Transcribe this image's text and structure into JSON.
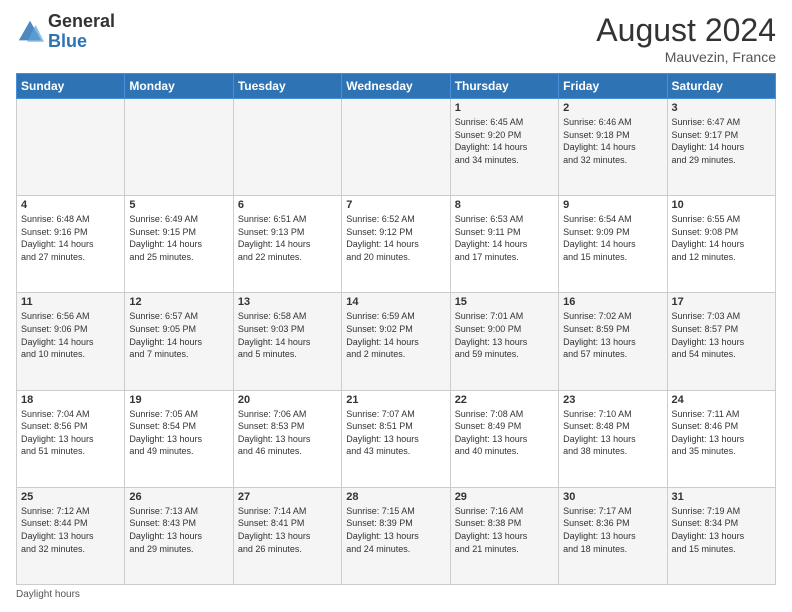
{
  "header": {
    "logo_general": "General",
    "logo_blue": "Blue",
    "month_year": "August 2024",
    "location": "Mauvezin, France"
  },
  "days_of_week": [
    "Sunday",
    "Monday",
    "Tuesday",
    "Wednesday",
    "Thursday",
    "Friday",
    "Saturday"
  ],
  "footer": {
    "daylight_label": "Daylight hours"
  },
  "weeks": [
    {
      "days": [
        {
          "num": "",
          "info": ""
        },
        {
          "num": "",
          "info": ""
        },
        {
          "num": "",
          "info": ""
        },
        {
          "num": "",
          "info": ""
        },
        {
          "num": "1",
          "info": "Sunrise: 6:45 AM\nSunset: 9:20 PM\nDaylight: 14 hours\nand 34 minutes."
        },
        {
          "num": "2",
          "info": "Sunrise: 6:46 AM\nSunset: 9:18 PM\nDaylight: 14 hours\nand 32 minutes."
        },
        {
          "num": "3",
          "info": "Sunrise: 6:47 AM\nSunset: 9:17 PM\nDaylight: 14 hours\nand 29 minutes."
        }
      ]
    },
    {
      "days": [
        {
          "num": "4",
          "info": "Sunrise: 6:48 AM\nSunset: 9:16 PM\nDaylight: 14 hours\nand 27 minutes."
        },
        {
          "num": "5",
          "info": "Sunrise: 6:49 AM\nSunset: 9:15 PM\nDaylight: 14 hours\nand 25 minutes."
        },
        {
          "num": "6",
          "info": "Sunrise: 6:51 AM\nSunset: 9:13 PM\nDaylight: 14 hours\nand 22 minutes."
        },
        {
          "num": "7",
          "info": "Sunrise: 6:52 AM\nSunset: 9:12 PM\nDaylight: 14 hours\nand 20 minutes."
        },
        {
          "num": "8",
          "info": "Sunrise: 6:53 AM\nSunset: 9:11 PM\nDaylight: 14 hours\nand 17 minutes."
        },
        {
          "num": "9",
          "info": "Sunrise: 6:54 AM\nSunset: 9:09 PM\nDaylight: 14 hours\nand 15 minutes."
        },
        {
          "num": "10",
          "info": "Sunrise: 6:55 AM\nSunset: 9:08 PM\nDaylight: 14 hours\nand 12 minutes."
        }
      ]
    },
    {
      "days": [
        {
          "num": "11",
          "info": "Sunrise: 6:56 AM\nSunset: 9:06 PM\nDaylight: 14 hours\nand 10 minutes."
        },
        {
          "num": "12",
          "info": "Sunrise: 6:57 AM\nSunset: 9:05 PM\nDaylight: 14 hours\nand 7 minutes."
        },
        {
          "num": "13",
          "info": "Sunrise: 6:58 AM\nSunset: 9:03 PM\nDaylight: 14 hours\nand 5 minutes."
        },
        {
          "num": "14",
          "info": "Sunrise: 6:59 AM\nSunset: 9:02 PM\nDaylight: 14 hours\nand 2 minutes."
        },
        {
          "num": "15",
          "info": "Sunrise: 7:01 AM\nSunset: 9:00 PM\nDaylight: 13 hours\nand 59 minutes."
        },
        {
          "num": "16",
          "info": "Sunrise: 7:02 AM\nSunset: 8:59 PM\nDaylight: 13 hours\nand 57 minutes."
        },
        {
          "num": "17",
          "info": "Sunrise: 7:03 AM\nSunset: 8:57 PM\nDaylight: 13 hours\nand 54 minutes."
        }
      ]
    },
    {
      "days": [
        {
          "num": "18",
          "info": "Sunrise: 7:04 AM\nSunset: 8:56 PM\nDaylight: 13 hours\nand 51 minutes."
        },
        {
          "num": "19",
          "info": "Sunrise: 7:05 AM\nSunset: 8:54 PM\nDaylight: 13 hours\nand 49 minutes."
        },
        {
          "num": "20",
          "info": "Sunrise: 7:06 AM\nSunset: 8:53 PM\nDaylight: 13 hours\nand 46 minutes."
        },
        {
          "num": "21",
          "info": "Sunrise: 7:07 AM\nSunset: 8:51 PM\nDaylight: 13 hours\nand 43 minutes."
        },
        {
          "num": "22",
          "info": "Sunrise: 7:08 AM\nSunset: 8:49 PM\nDaylight: 13 hours\nand 40 minutes."
        },
        {
          "num": "23",
          "info": "Sunrise: 7:10 AM\nSunset: 8:48 PM\nDaylight: 13 hours\nand 38 minutes."
        },
        {
          "num": "24",
          "info": "Sunrise: 7:11 AM\nSunset: 8:46 PM\nDaylight: 13 hours\nand 35 minutes."
        }
      ]
    },
    {
      "days": [
        {
          "num": "25",
          "info": "Sunrise: 7:12 AM\nSunset: 8:44 PM\nDaylight: 13 hours\nand 32 minutes."
        },
        {
          "num": "26",
          "info": "Sunrise: 7:13 AM\nSunset: 8:43 PM\nDaylight: 13 hours\nand 29 minutes."
        },
        {
          "num": "27",
          "info": "Sunrise: 7:14 AM\nSunset: 8:41 PM\nDaylight: 13 hours\nand 26 minutes."
        },
        {
          "num": "28",
          "info": "Sunrise: 7:15 AM\nSunset: 8:39 PM\nDaylight: 13 hours\nand 24 minutes."
        },
        {
          "num": "29",
          "info": "Sunrise: 7:16 AM\nSunset: 8:38 PM\nDaylight: 13 hours\nand 21 minutes."
        },
        {
          "num": "30",
          "info": "Sunrise: 7:17 AM\nSunset: 8:36 PM\nDaylight: 13 hours\nand 18 minutes."
        },
        {
          "num": "31",
          "info": "Sunrise: 7:19 AM\nSunset: 8:34 PM\nDaylight: 13 hours\nand 15 minutes."
        }
      ]
    }
  ]
}
